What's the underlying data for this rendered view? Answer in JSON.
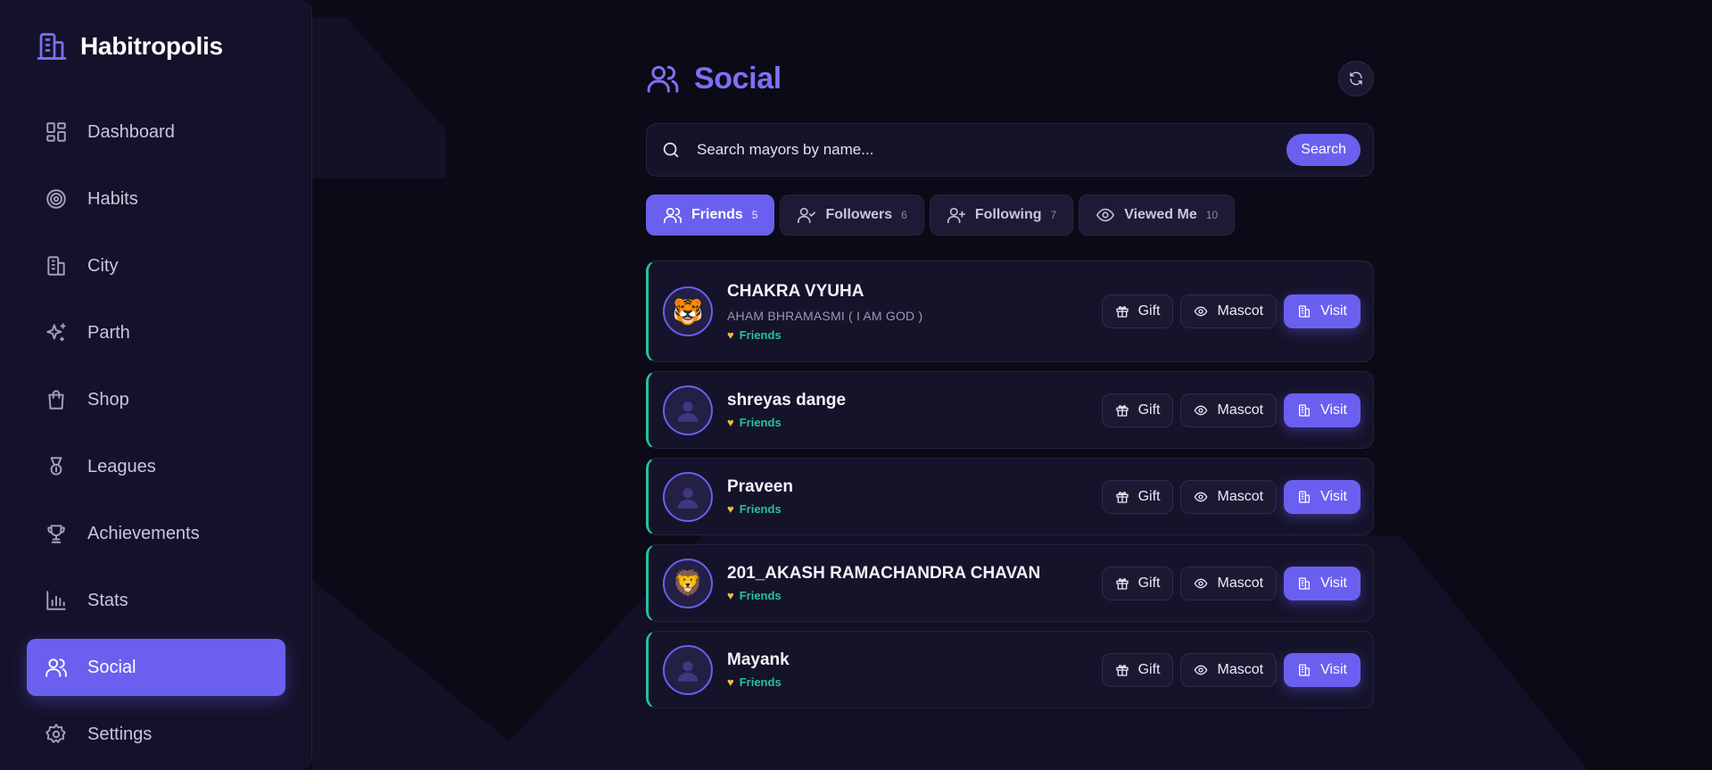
{
  "app": {
    "name": "Habitropolis"
  },
  "sidebar": {
    "items": [
      {
        "label": "Dashboard",
        "icon": "dashboard-icon"
      },
      {
        "label": "Habits",
        "icon": "target-icon"
      },
      {
        "label": "City",
        "icon": "building-icon"
      },
      {
        "label": "Parth",
        "icon": "sparkles-icon"
      },
      {
        "label": "Shop",
        "icon": "shopping-bag-icon"
      },
      {
        "label": "Leagues",
        "icon": "medal-icon"
      },
      {
        "label": "Achievements",
        "icon": "trophy-icon"
      },
      {
        "label": "Stats",
        "icon": "bar-chart-icon"
      },
      {
        "label": "Social",
        "icon": "users-icon",
        "active": true
      },
      {
        "label": "Settings",
        "icon": "gear-icon"
      }
    ]
  },
  "main": {
    "title": "Social",
    "search": {
      "placeholder": "Search mayors by name...",
      "button": "Search"
    },
    "tabs": [
      {
        "label": "Friends",
        "count": "5",
        "active": true
      },
      {
        "label": "Followers",
        "count": "6"
      },
      {
        "label": "Following",
        "count": "7"
      },
      {
        "label": "Viewed Me",
        "count": "10"
      }
    ],
    "friends": [
      {
        "name": "CHAKRA VYUHA",
        "subtitle": "AHAM BHRAMASMI ( I AM GOD )",
        "status": "Friends",
        "avatar": "🐯"
      },
      {
        "name": "shreyas dange",
        "status": "Friends",
        "avatar": "default"
      },
      {
        "name": "Praveen",
        "status": "Friends",
        "avatar": "default"
      },
      {
        "name": "201_AKASH RAMACHANDRA CHAVAN",
        "status": "Friends",
        "avatar": "🦁"
      },
      {
        "name": "Mayank",
        "status": "Friends",
        "avatar": "default"
      }
    ],
    "actions": {
      "gift": "Gift",
      "mascot": "Mascot",
      "visit": "Visit"
    }
  },
  "colors": {
    "accent": "#6b5ff0",
    "friend_status": "#25c39a",
    "background": "#0b0a16",
    "sidebar": "#14122a"
  }
}
